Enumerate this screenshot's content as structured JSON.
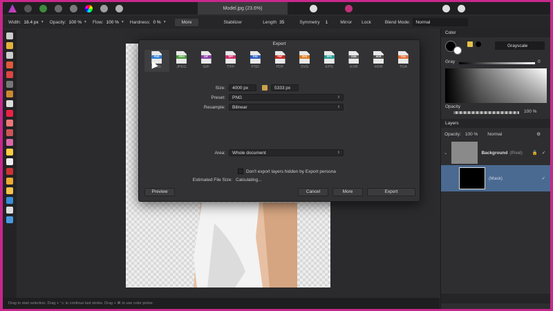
{
  "document": {
    "title": "Model.jpg (23.6%)"
  },
  "context_toolbar": {
    "width_label": "Width:",
    "width_value": "18.4 px",
    "opacity_label": "Opacity:",
    "opacity_value": "100 %",
    "flow_label": "Flow:",
    "flow_value": "100 %",
    "hardness_label": "Hardness:",
    "hardness_value": "0 %",
    "more_label": "More",
    "stabilizer_label": "Stabilizer",
    "length_label": "Length",
    "length_value": "35",
    "symmetry_label": "Symmetry",
    "symmetry_value": "1",
    "mirror_label": "Mirror",
    "lock_label": "Lock",
    "blend_label": "Blend Mode:",
    "blend_value": "Normal"
  },
  "export_dialog": {
    "title": "Export",
    "formats": [
      "PNG",
      "JPEG",
      "GIF",
      "TIFF",
      "PSD",
      "PDF",
      "SVG",
      "EPS",
      "EXR",
      "HDR",
      "TGA"
    ],
    "format_colors": [
      "#2f7fd0",
      "#4c9a3a",
      "#8b3fa6",
      "#d0306b",
      "#2c5fc4",
      "#c42a24",
      "#e07d22",
      "#2a9e9a",
      "#606060",
      "#4d4d4d",
      "#e0703a"
    ],
    "selected_format": "PNG",
    "size_label": "Size:",
    "size_width": "4000 px",
    "size_height": "5333 px",
    "preset_label": "Preset:",
    "preset_value": "PNG",
    "resample_label": "Resample:",
    "resample_value": "Bilinear",
    "area_label": "Area:",
    "area_value": "Whole document",
    "dont_export_label": "Don't export layers hidden by Export persona",
    "file_size_label": "Estimated File Size:",
    "file_size_value": "Calculating...",
    "preview_label": "Preview",
    "cancel_label": "Cancel",
    "more_label": "More",
    "export_label": "Export"
  },
  "color_panel": {
    "title": "Color",
    "mode": "Grayscale",
    "gray_label": "Gray",
    "gray_value": "0",
    "opacity_label": "Opacity",
    "opacity_value": "100 %"
  },
  "layers_panel": {
    "title": "Layers",
    "opacity_label": "Opacity:",
    "opacity_value": "100 %",
    "blend_value": "Normal",
    "layers": [
      {
        "name": "Background",
        "type": "(Pixel)"
      },
      {
        "name": "(Mask)",
        "type": ""
      }
    ]
  },
  "status_text": "Drag to start selection. Drag + ⌥ to continue last stroke. Drag + ⌘ to use color picker."
}
